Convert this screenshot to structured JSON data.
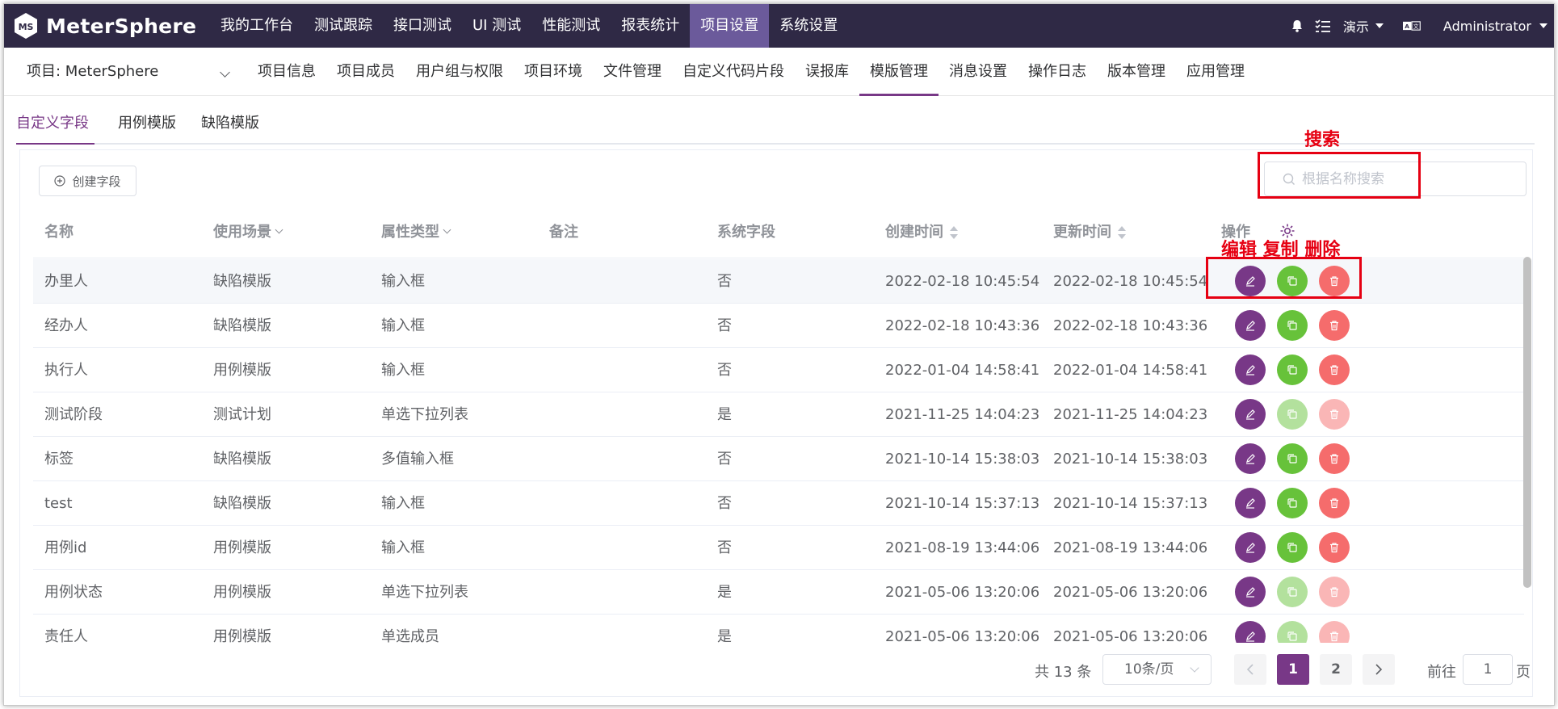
{
  "app": {
    "logo_text": "MeterSphere"
  },
  "topnav": {
    "items": [
      {
        "label": "我的工作台",
        "active": false
      },
      {
        "label": "测试跟踪",
        "active": false
      },
      {
        "label": "接口测试",
        "active": false
      },
      {
        "label": "UI 测试",
        "active": false
      },
      {
        "label": "性能测试",
        "active": false
      },
      {
        "label": "报表统计",
        "active": false
      },
      {
        "label": "项目设置",
        "active": true
      },
      {
        "label": "系统设置",
        "active": false
      }
    ],
    "workspace": "演示",
    "user": "Administrator"
  },
  "subnav": {
    "project": "项目: MeterSphere",
    "items": [
      {
        "label": "项目信息"
      },
      {
        "label": "项目成员"
      },
      {
        "label": "用户组与权限"
      },
      {
        "label": "项目环境"
      },
      {
        "label": "文件管理"
      },
      {
        "label": "自定义代码片段"
      },
      {
        "label": "误报库"
      },
      {
        "label": "模版管理",
        "active": true
      },
      {
        "label": "消息设置"
      },
      {
        "label": "操作日志"
      },
      {
        "label": "版本管理"
      },
      {
        "label": "应用管理"
      }
    ]
  },
  "tabs": [
    "自定义字段",
    "用例模版",
    "缺陷模版"
  ],
  "toolbar": {
    "create_label": "创建字段",
    "search_placeholder": "根据名称搜索"
  },
  "table": {
    "columns": [
      "名称",
      "使用场景",
      "属性类型",
      "备注",
      "系统字段",
      "创建时间",
      "更新时间",
      "操作"
    ],
    "rows": [
      {
        "name": "办里人",
        "scene": "缺陷模版",
        "type": "输入框",
        "remark": "",
        "system": "否",
        "created": "2022-02-18 10:45:54",
        "updated": "2022-02-18 10:45:54"
      },
      {
        "name": "经办人",
        "scene": "缺陷模版",
        "type": "输入框",
        "remark": "",
        "system": "否",
        "created": "2022-02-18 10:43:36",
        "updated": "2022-02-18 10:43:36"
      },
      {
        "name": "执行人",
        "scene": "用例模版",
        "type": "输入框",
        "remark": "",
        "system": "否",
        "created": "2022-01-04 14:58:41",
        "updated": "2022-01-04 14:58:41"
      },
      {
        "name": "测试阶段",
        "scene": "测试计划",
        "type": "单选下拉列表",
        "remark": "",
        "system": "是",
        "created": "2021-11-25 14:04:23",
        "updated": "2021-11-25 14:04:23"
      },
      {
        "name": "标签",
        "scene": "缺陷模版",
        "type": "多值输入框",
        "remark": "",
        "system": "否",
        "created": "2021-10-14 15:38:03",
        "updated": "2021-10-14 15:38:03"
      },
      {
        "name": "test",
        "scene": "缺陷模版",
        "type": "输入框",
        "remark": "",
        "system": "否",
        "created": "2021-10-14 15:37:13",
        "updated": "2021-10-14 15:37:13"
      },
      {
        "name": "用例id",
        "scene": "用例模版",
        "type": "输入框",
        "remark": "",
        "system": "否",
        "created": "2021-08-19 13:44:06",
        "updated": "2021-08-19 13:44:06"
      },
      {
        "name": "用例状态",
        "scene": "用例模版",
        "type": "单选下拉列表",
        "remark": "",
        "system": "是",
        "created": "2021-05-06 13:20:06",
        "updated": "2021-05-06 13:20:06"
      },
      {
        "name": "责任人",
        "scene": "用例模版",
        "type": "单选成员",
        "remark": "",
        "system": "是",
        "created": "2021-05-06 13:20:06",
        "updated": "2021-05-06 13:20:06"
      }
    ]
  },
  "pagination": {
    "total": "共 13 条",
    "page_size": "10条/页",
    "pages": [
      "1",
      "2"
    ],
    "current": "1",
    "goto_prefix": "前往",
    "goto_value": "1",
    "goto_suffix": "页"
  },
  "annotations": {
    "search": "搜索",
    "actions": "编辑 复制 删除"
  },
  "colors": {
    "nav_bg": "#2f2945",
    "nav_active": "#6b5a9b",
    "accent": "#783887",
    "copy": "#67c23a",
    "delete": "#f56c6c",
    "annotation": "#e60012"
  }
}
